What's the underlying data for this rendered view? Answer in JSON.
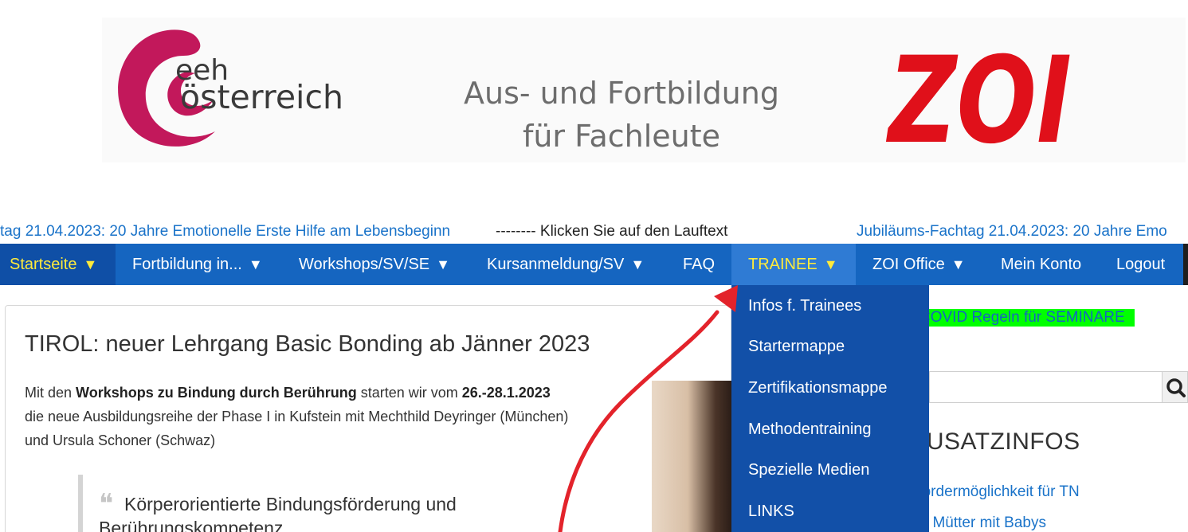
{
  "banner": {
    "eeh_logo_line1": "eeh",
    "eeh_logo_line2": "österreich",
    "subtitle_line1": "Aus- und Fortbildung",
    "subtitle_line2": "für Fachleute",
    "zoi_logo": "ZOI",
    "colors": {
      "eeh_magenta": "#c2185b",
      "zoi_red": "#e0101a"
    }
  },
  "ticker": {
    "text1": "tag 21.04.2023: 20 Jahre Emotionelle Erste Hilfe am Lebensbeginn",
    "text2": "-------- Klicken Sie auf den Lauftext",
    "text3": "Jubiläums-Fachtag 21.04.2023: 20 Jahre Emo"
  },
  "navbar": {
    "items": [
      {
        "label": "Startseite",
        "caret": "▼"
      },
      {
        "label": "Fortbildung in...",
        "caret": "▼"
      },
      {
        "label": "Workshops/SV/SE",
        "caret": "▼"
      },
      {
        "label": "Kursanmeldung/SV",
        "caret": "▼"
      },
      {
        "label": "FAQ"
      },
      {
        "label": "TRAINEE",
        "caret": "▼"
      },
      {
        "label": "ZOI Office",
        "caret": "▼"
      },
      {
        "label": "Mein Konto"
      },
      {
        "label": "Logout"
      }
    ],
    "colors": {
      "bar": "#1565c0",
      "active_text": "#ffeb3b"
    }
  },
  "dropdown": {
    "items": [
      {
        "label": "Infos f. Trainees"
      },
      {
        "label": "Startermappe"
      },
      {
        "label": "Zertifikationsmappe"
      },
      {
        "label": "Methodentraining"
      },
      {
        "label": "Spezielle Medien"
      },
      {
        "label": "LINKS"
      }
    ]
  },
  "article": {
    "title": "TIROL: neuer Lehrgang Basic Bonding ab Jänner 2023",
    "p1_a": "Mit den ",
    "p1_b": "Workshops zu Bindung durch Berührung",
    "p1_c": " starten wir vom ",
    "p1_d": "26.-28.1.2023",
    "p2": "die neue Ausbildungsreihe der Phase I in Kufstein mit Mechthild Deyringer (München)",
    "p3": "und Ursula Schoner (Schwaz)",
    "quote": "Körperorientierte Bindungsförderung und Berührungskompetenz"
  },
  "sidebar": {
    "covid_banner": "COVID Regeln für SEMINARE",
    "heading": "ZUSATZINFOS",
    "link1": "Fördermöglichkeit für TN",
    "link2": "für Mütter mit Babys"
  }
}
